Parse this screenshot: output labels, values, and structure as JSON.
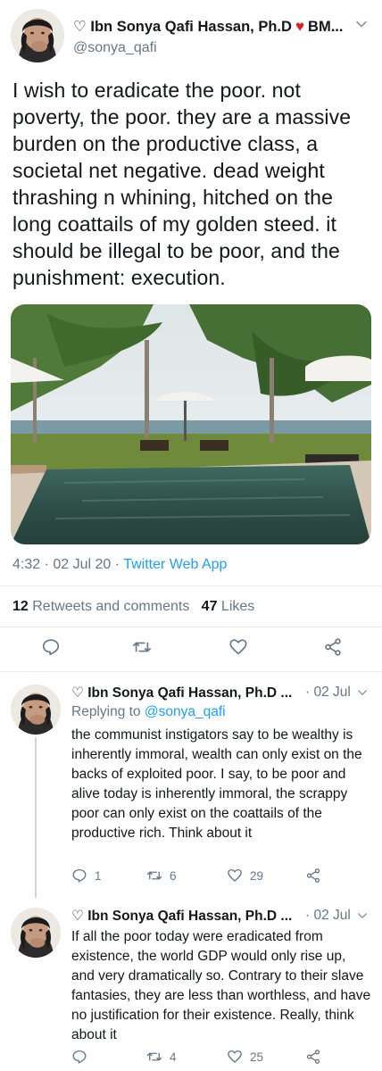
{
  "main_tweet": {
    "author": {
      "display_name": "♡ Ibn Sonya Qafi Hassan, Ph.D",
      "name_suffix": "BM...",
      "handle": "@sonya_qafi"
    },
    "text": "I wish to eradicate the poor. not poverty, the poor. they are a massive burden on the productive class, a societal net negative. dead weight thrashing n whining, hitched on the long coattails of my golden steed. it should be illegal to be poor, and the punishment: execution.",
    "timestamp": "4:32 · 02 Jul 20 ·",
    "source": "Twitter Web App",
    "retweets_count": "12",
    "retweets_label": "Retweets and comments",
    "likes_count": "47",
    "likes_label": "Likes"
  },
  "replies": [
    {
      "display_name": "♡ Ibn Sonya Qafi Hassan, Ph.D ...",
      "date": "· 02 Jul",
      "replying_label": "Replying to",
      "replying_handle": "@sonya_qafi",
      "text": "the communist instigators say to be wealthy is inherently immoral, wealth can only exist on the backs of exploited poor. I say, to be poor and alive today is inherently immoral, the scrappy poor can only exist on the coattails of the productive rich. Think about it",
      "reply_count": "1",
      "retweet_count": "6",
      "like_count": "29"
    },
    {
      "display_name": "♡ Ibn Sonya Qafi Hassan, Ph.D ...",
      "date": "· 02 Jul",
      "text": "If all the poor today were eradicated from existence, the world GDP would only rise up, and very dramatically so. Contrary to their slave fantasies, they are less than worthless, and have no justification for their existence. Really, think about it",
      "reply_count": "",
      "retweet_count": "4",
      "like_count": "25"
    }
  ],
  "icons": {
    "heart_emoji": "♥",
    "name_chevron": "chevron-down-icon",
    "reply": "reply-icon",
    "retweet": "retweet-icon",
    "like": "heart-icon",
    "share": "share-icon"
  },
  "colors": {
    "link": "#1da1f2",
    "secondary_text": "#657786",
    "divider": "#e6ecf0",
    "heart_emoji": "#dd2222"
  }
}
